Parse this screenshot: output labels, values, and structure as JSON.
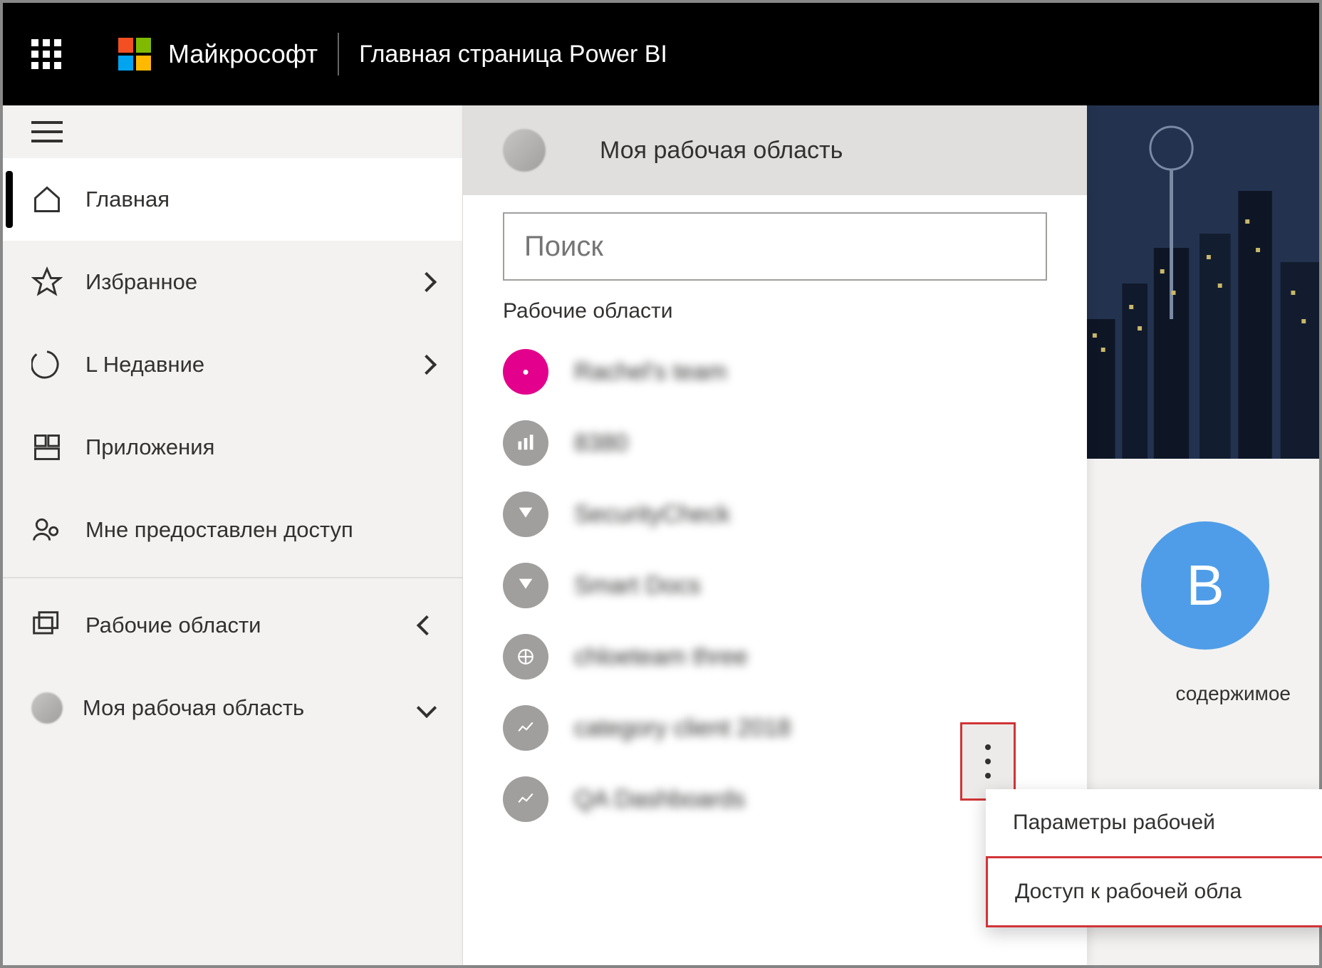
{
  "header": {
    "brand": "Майкрософт",
    "app_title": "Главная страница Power BI"
  },
  "nav": {
    "home": "Главная",
    "favorites": "Избранное",
    "recent": "L Недавние",
    "apps": "Приложения",
    "shared": "Мне предоставлен доступ",
    "workspaces": "Рабочие области",
    "my_workspace": "Моя рабочая область"
  },
  "ws_panel": {
    "title": "Моя рабочая область",
    "search_placeholder": "Поиск",
    "section_label": "Рабочие области",
    "items": [
      {
        "name": "Rachel's team",
        "color": "magenta"
      },
      {
        "name": "8380",
        "color": "grey"
      },
      {
        "name": "SecurityCheck",
        "color": "grey"
      },
      {
        "name": "Smart Docs",
        "color": "grey"
      },
      {
        "name": "chloeteam three",
        "color": "grey"
      },
      {
        "name": "category client 2018",
        "color": "grey"
      },
      {
        "name": "QA Dashboards",
        "color": "grey"
      }
    ]
  },
  "right": {
    "circle_letter": "В",
    "card_label": "содержимое"
  },
  "context_menu": {
    "item1": "Параметры рабочей",
    "item2": "Доступ к рабочей обла"
  }
}
